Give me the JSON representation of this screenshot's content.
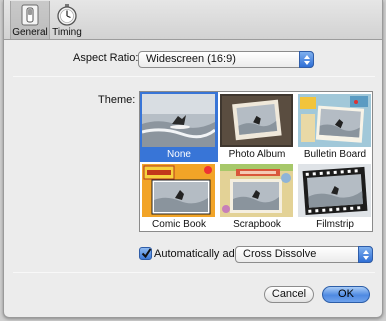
{
  "toolbar": {
    "items": [
      {
        "label": "General",
        "icon": "switch-icon",
        "selected": true
      },
      {
        "label": "Timing",
        "icon": "stopwatch-icon",
        "selected": false
      }
    ]
  },
  "aspect_ratio": {
    "label": "Aspect Ratio:",
    "value": "Widescreen (16:9)"
  },
  "theme": {
    "label": "Theme:",
    "selected": "None",
    "items": [
      {
        "name": "None"
      },
      {
        "name": "Photo Album"
      },
      {
        "name": "Bulletin Board"
      },
      {
        "name": "Comic Book"
      },
      {
        "name": "Scrapbook"
      },
      {
        "name": "Filmstrip"
      }
    ]
  },
  "auto_add": {
    "label": "Automatically add:",
    "checked": true,
    "value": "Cross Dissolve"
  },
  "buttons": {
    "cancel": "Cancel",
    "ok": "OK"
  },
  "colors": {
    "selection": "#3875d7",
    "accent_blue": "#4f8ae2"
  }
}
